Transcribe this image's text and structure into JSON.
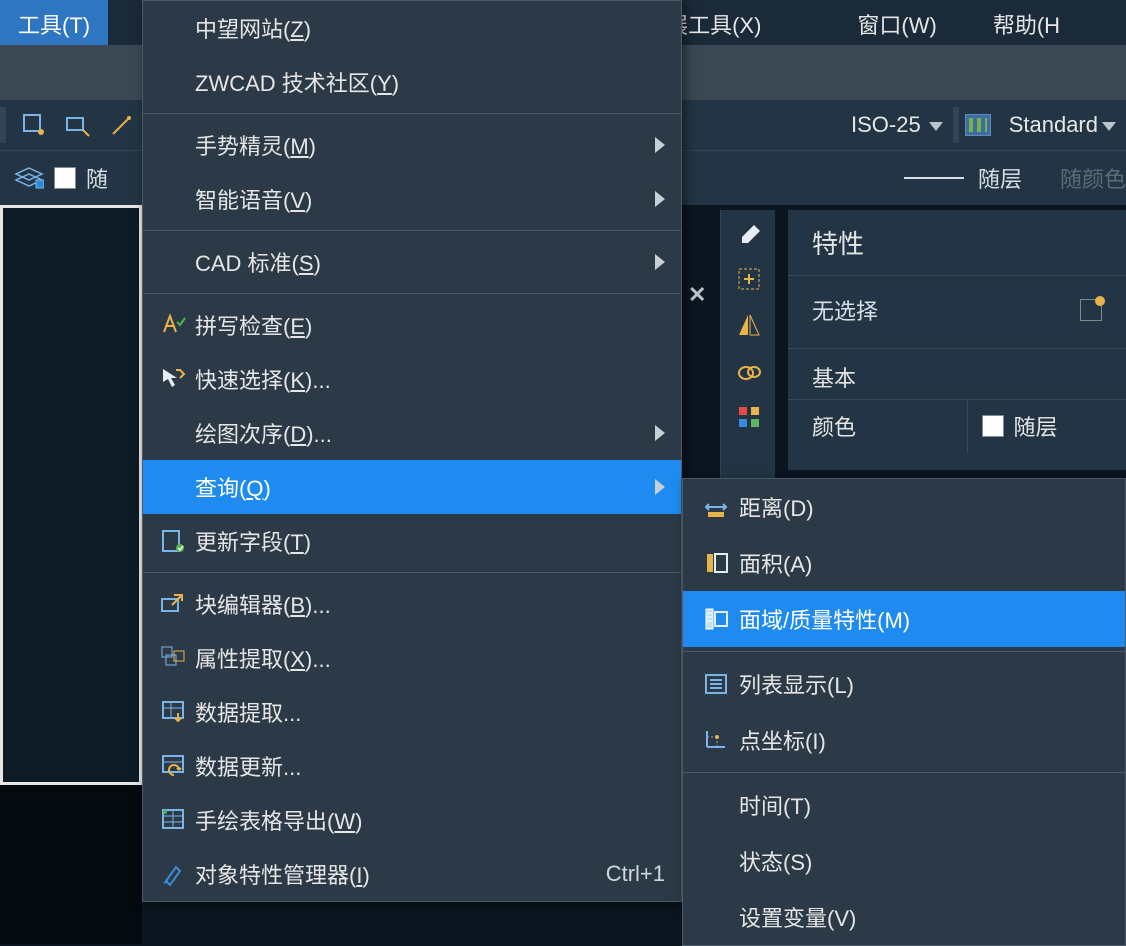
{
  "menubar": {
    "tools": "工具(T)",
    "ext_tools": "展工具(X)",
    "window": "窗口(W)",
    "help": "帮助(H"
  },
  "tb1": {
    "dimstyle": "ISO-25",
    "textstyle": "Standard"
  },
  "tb2": {
    "label_left": "随",
    "bylayer": "随层",
    "bycolor": "随颜色"
  },
  "menu": {
    "items": [
      {
        "label": "中望网站(",
        "u": "Z",
        "tail": ")"
      },
      {
        "label": "ZWCAD 技术社区(",
        "u": "Y",
        "tail": ")"
      },
      {
        "sep": true
      },
      {
        "label": "手势精灵(",
        "u": "M",
        "tail": ")",
        "arrow": true
      },
      {
        "label": "智能语音(",
        "u": "V",
        "tail": ")",
        "arrow": true
      },
      {
        "sep": true
      },
      {
        "label": "CAD 标准(",
        "u": "S",
        "tail": ")",
        "arrow": true
      },
      {
        "sep": true
      },
      {
        "icon": "spell",
        "label": "拼写检查(",
        "u": "E",
        "tail": ")"
      },
      {
        "icon": "qsel",
        "label": "快速选择(",
        "u": "K",
        "tail": ")..."
      },
      {
        "label": "绘图次序(",
        "u": "D",
        "tail": ")...",
        "arrow": true
      },
      {
        "icon": "query",
        "label": "查询(",
        "u": "Q",
        "tail": ")",
        "arrow": true,
        "hi": true
      },
      {
        "icon": "upfield",
        "label": "更新字段(",
        "u": "T",
        "tail": ")"
      },
      {
        "sep": true
      },
      {
        "icon": "bedit",
        "label": "块编辑器(",
        "u": "B",
        "tail": ")..."
      },
      {
        "icon": "attext",
        "label": "属性提取(",
        "u": "X",
        "tail": ")..."
      },
      {
        "icon": "dext",
        "label": "数据提取..."
      },
      {
        "icon": "dupd",
        "label": "数据更新..."
      },
      {
        "icon": "texp",
        "label": "手绘表格导出(",
        "u": "W",
        "tail": ")"
      },
      {
        "icon": "props",
        "label": "对象特性管理器(",
        "u": "I",
        "tail": ")",
        "shortcut": "Ctrl+1"
      }
    ]
  },
  "submenu": {
    "items": [
      {
        "icon": "dist",
        "label": "距离(",
        "u": "D",
        "tail": ")"
      },
      {
        "icon": "area",
        "label": "面积(",
        "u": "A",
        "tail": ")"
      },
      {
        "icon": "massprop",
        "label": "面域/质量特性(",
        "u": "M",
        "tail": ")",
        "hi": true
      },
      {
        "sep": true
      },
      {
        "icon": "list",
        "label": "列表显示(",
        "u": "L",
        "tail": ")"
      },
      {
        "icon": "id",
        "label": "点坐标(",
        "u": "I",
        "tail": ")"
      },
      {
        "sep": true
      },
      {
        "label": "时间(",
        "u": "T",
        "tail": ")"
      },
      {
        "label": "状态(",
        "u": "S",
        "tail": ")"
      },
      {
        "label": "设置变量(",
        "u": "V",
        "tail": ")"
      }
    ]
  },
  "props": {
    "title": "特性",
    "selection": "无选择",
    "section_basic": "基本",
    "k_color": "颜色",
    "v_color": "随层"
  }
}
